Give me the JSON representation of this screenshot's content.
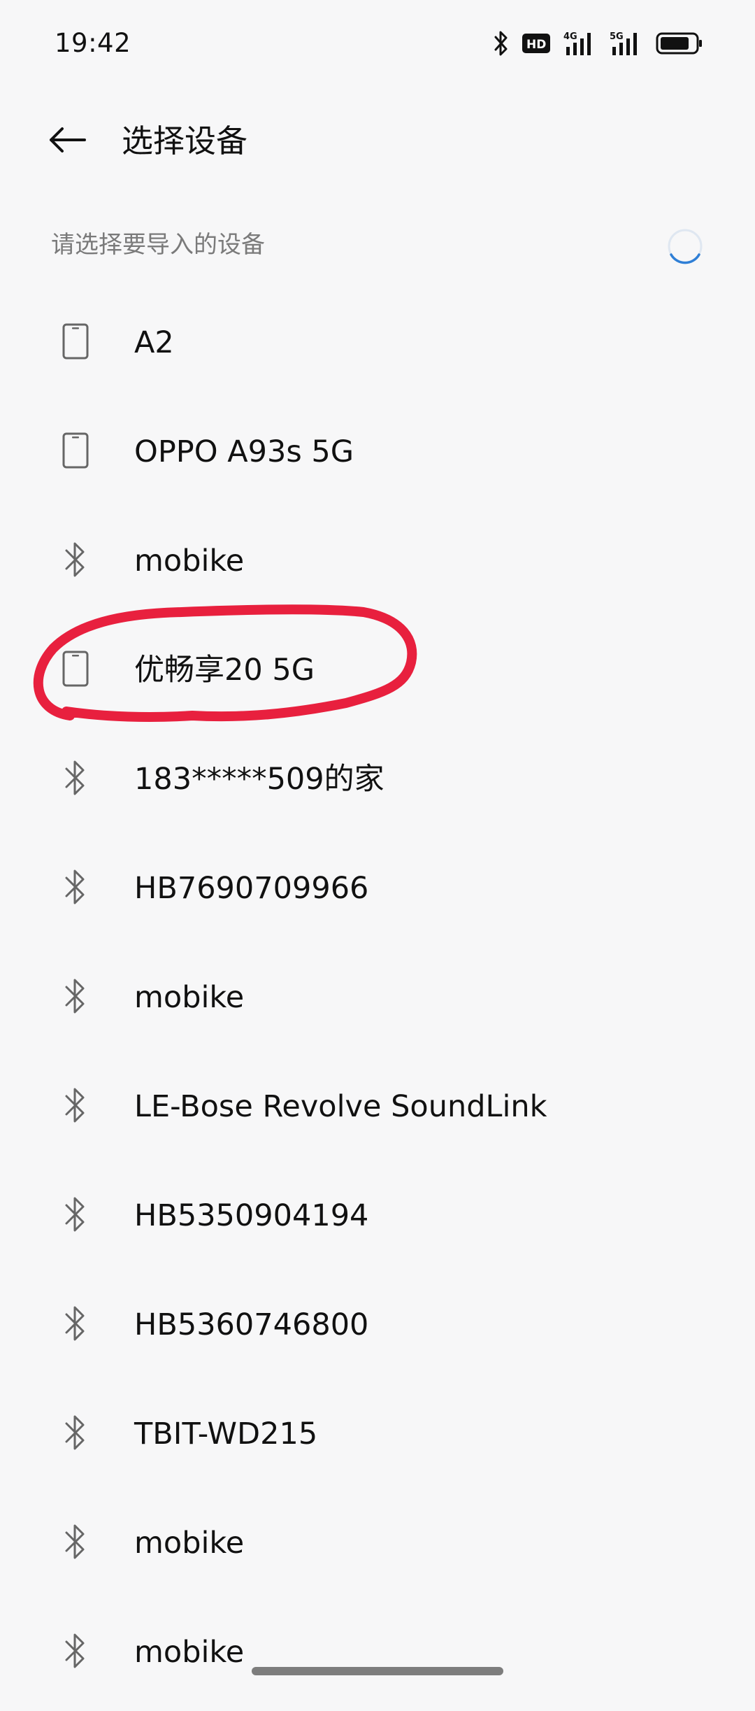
{
  "status_bar": {
    "time": "19:42",
    "icons": [
      "bluetooth-icon",
      "hd-icon",
      "4g-signal-icon",
      "5g-signal-icon",
      "battery-icon"
    ],
    "hd_label": "HD",
    "net1": "4G",
    "net2": "5G"
  },
  "header": {
    "title": "选择设备",
    "back_icon": "arrow-left-icon"
  },
  "section": {
    "hint": "请选择要导入的设备",
    "loading": true
  },
  "devices": [
    {
      "name": "A2",
      "type": "phone"
    },
    {
      "name": "OPPO A93s 5G",
      "type": "phone"
    },
    {
      "name": "mobike",
      "type": "bluetooth"
    },
    {
      "name": "优畅享20 5G",
      "type": "phone"
    },
    {
      "name": "183*****509的家",
      "type": "bluetooth"
    },
    {
      "name": "HB7690709966",
      "type": "bluetooth"
    },
    {
      "name": "mobike",
      "type": "bluetooth"
    },
    {
      "name": "LE-Bose Revolve SoundLink",
      "type": "bluetooth"
    },
    {
      "name": "HB5350904194",
      "type": "bluetooth"
    },
    {
      "name": "HB5360746800",
      "type": "bluetooth"
    },
    {
      "name": "TBIT-WD215",
      "type": "bluetooth"
    },
    {
      "name": "mobike",
      "type": "bluetooth"
    },
    {
      "name": "mobike",
      "type": "bluetooth"
    }
  ],
  "colors": {
    "background": "#f7f7f8",
    "text": "#111111",
    "hint": "#7a7a7a",
    "icon": "#666666",
    "accent": "#2f7fd6",
    "annotation": "#e8203e"
  }
}
